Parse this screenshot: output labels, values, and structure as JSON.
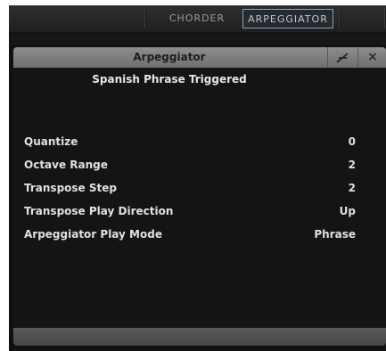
{
  "tabs": [
    {
      "label": "CHORDER",
      "active": false
    },
    {
      "label": "ARPEGGIATOR",
      "active": true
    }
  ],
  "panel": {
    "title": "Arpeggiator",
    "pin_icon": "pin-icon",
    "close_icon": "close-icon",
    "close_glyph": "×",
    "status": "Spanish Phrase Triggered",
    "params": [
      {
        "label": "Quantize",
        "value": "0"
      },
      {
        "label": "Octave Range",
        "value": "2"
      },
      {
        "label": "Transpose Step",
        "value": "2"
      },
      {
        "label": "Transpose Play Direction",
        "value": "Up"
      },
      {
        "label": "Arpeggiator Play Mode",
        "value": "Phrase"
      }
    ]
  },
  "colors": {
    "active_tab_border": "#8ea0b0",
    "panel_bg": "#141414",
    "titlebar": "#7e7e7e"
  }
}
